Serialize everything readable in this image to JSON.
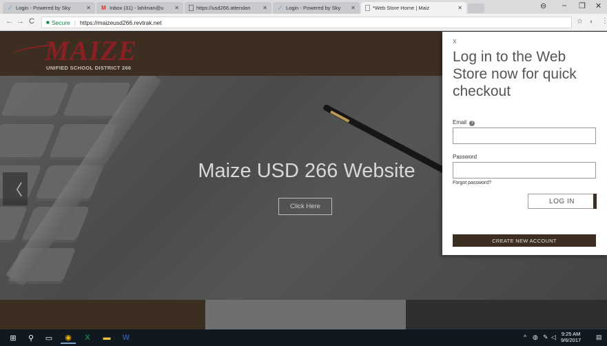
{
  "browser": {
    "tabs": [
      {
        "label": "Login - Powered by Sky",
        "icon": "skyward-icon"
      },
      {
        "label": "Inbox (31) - lahlman@u",
        "icon": "gmail-icon"
      },
      {
        "label": "https://usd266.attendan",
        "icon": "page-icon"
      },
      {
        "label": "Login - Powered by Sky",
        "icon": "skyward-icon"
      },
      {
        "label": "*Web Store Home | Maiz",
        "icon": "page-icon",
        "active": true
      }
    ],
    "address": {
      "secure_label": "Secure",
      "url": "https://maizeusd266.revtrak.net"
    }
  },
  "site": {
    "logo_text": "MAIZE",
    "logo_subtitle": "UNIFIED SCHOOL DISTRICT 266",
    "hero_title": "Maize USD 266 Website",
    "hero_button": "Click Here",
    "prev_arrow": "〈"
  },
  "login": {
    "close": "x",
    "title": "Log in to the Web Store now for quick checkout",
    "email_label": "Email",
    "email_value": "",
    "password_label": "Password",
    "password_value": "",
    "forgot": "Forgot password?",
    "login_button": "LOG IN",
    "create_button": "CREATE NEW ACCOUNT"
  },
  "taskbar": {
    "time": "9:25 AM",
    "date": "9/6/2017"
  },
  "colors": {
    "brand_brown": "#3d2e22",
    "brand_maroon": "#8a1f24",
    "secure_green": "#0b8043"
  }
}
